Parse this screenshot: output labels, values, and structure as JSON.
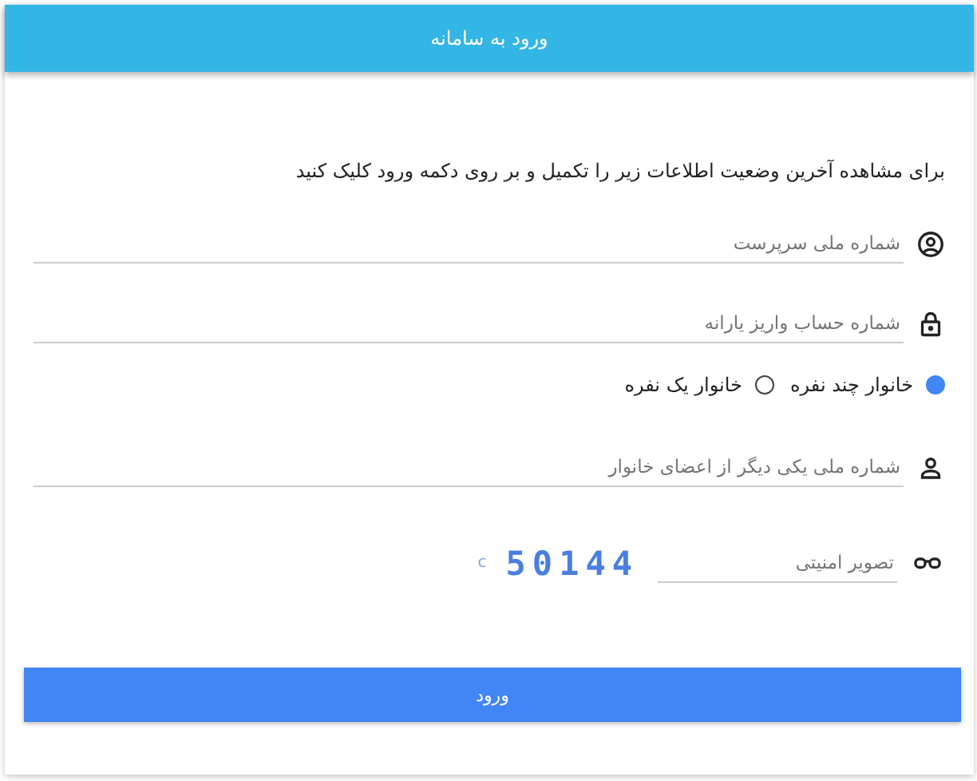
{
  "header": {
    "title": "ورود به سامانه"
  },
  "instruction": "برای مشاهده آخرین وضعیت اطلاعات زیر را تکمیل و بر روی دکمه ورود کلیک کنید",
  "fields": [
    {
      "kind": "person-circle",
      "placeholder": "شماره ملی سرپرست"
    },
    {
      "kind": "lock",
      "placeholder": "شماره حساب واریز یارانه"
    }
  ],
  "family_options": [
    {
      "label": "خانوار چند نفره",
      "selected": true
    },
    {
      "label": "خانوار یک نفره",
      "selected": false
    }
  ],
  "member_field": {
    "kind": "person",
    "placeholder": "شماره ملی یکی دیگر از اعضای خانوار"
  },
  "captcha": {
    "placeholder": "تصویر امنیتی",
    "code": "50144",
    "refresh": "c"
  },
  "submit": "ورود"
}
